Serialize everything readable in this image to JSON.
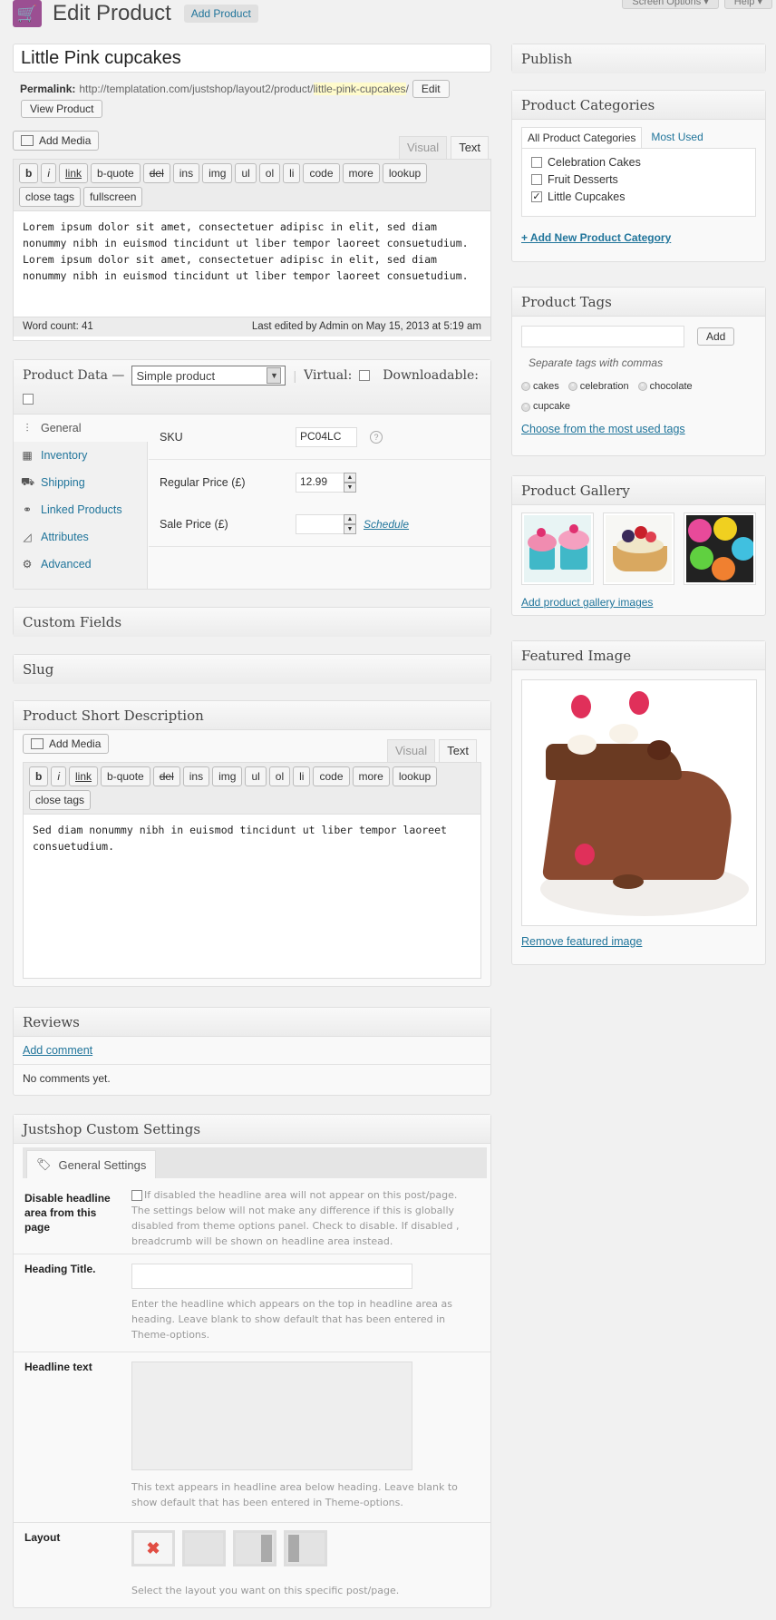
{
  "header": {
    "title": "Edit Product",
    "add_new": "Add Product",
    "screen_options": "Screen Options ▾",
    "help": "Help ▾"
  },
  "post": {
    "title": "Little Pink cupcakes",
    "permalink_label": "Permalink:",
    "permalink_base": "http://templatation.com/justshop/layout2/product/",
    "permalink_slug": "little-pink-cupcakes",
    "permalink_end": "/",
    "edit_btn": "Edit",
    "view_btn": "View Product"
  },
  "editor": {
    "add_media": "Add Media",
    "tab_visual": "Visual",
    "tab_text": "Text",
    "buttons": [
      "b",
      "i",
      "link",
      "b-quote",
      "del",
      "ins",
      "img",
      "ul",
      "ol",
      "li",
      "code",
      "more",
      "lookup",
      "close tags",
      "fullscreen"
    ],
    "content": "Lorem ipsum dolor sit amet, consectetuer adipisc in elit, sed diam nonummy nibh in euismod tincidunt ut liber tempor laoreet consuetudium. Lorem ipsum dolor sit amet, consectetuer adipisc in elit, sed diam nonummy nibh in euismod tincidunt ut liber tempor laoreet consuetudium.",
    "word_count": "Word count: 41",
    "last_edited": "Last edited by Admin on May 15, 2013 at 5:19 am"
  },
  "product_data": {
    "title": "Product Data —",
    "type": "Simple product",
    "virtual": "Virtual:",
    "downloadable": "Downloadable:",
    "tabs": [
      {
        "label": "General",
        "icon": "sliders-icon"
      },
      {
        "label": "Inventory",
        "icon": "boxes-icon"
      },
      {
        "label": "Shipping",
        "icon": "truck-icon"
      },
      {
        "label": "Linked Products",
        "icon": "link-icon"
      },
      {
        "label": "Attributes",
        "icon": "ruler-icon"
      },
      {
        "label": "Advanced",
        "icon": "gear-icon"
      }
    ],
    "sku_label": "SKU",
    "sku_value": "PC04LC",
    "regular_label": "Regular Price (£)",
    "regular_value": "12.99",
    "sale_label": "Sale Price (£)",
    "sale_value": "",
    "schedule": "Schedule"
  },
  "boxes": {
    "custom_fields": "Custom Fields",
    "slug": "Slug",
    "short_desc": "Product Short Description",
    "reviews": "Reviews"
  },
  "short_desc": {
    "add_media": "Add Media",
    "tab_visual": "Visual",
    "tab_text": "Text",
    "buttons": [
      "b",
      "i",
      "link",
      "b-quote",
      "del",
      "ins",
      "img",
      "ul",
      "ol",
      "li",
      "code",
      "more",
      "lookup",
      "close tags"
    ],
    "content": "Sed diam nonummy nibh in euismod tincidunt ut liber tempor laoreet consuetudium."
  },
  "reviews": {
    "add_comment": "Add comment",
    "empty": "No comments yet."
  },
  "justshop": {
    "title": "Justshop Custom Settings",
    "tab": "General Settings",
    "disable_label": "Disable headline area from this page",
    "disable_desc": "If disabled the headline area will not appear on this post/page. The settings below will not make any difference if this is globally disabled from theme options panel. Check to disable. If disabled , breadcrumb will be shown on headline area instead.",
    "heading_label": "Heading Title.",
    "heading_desc": "Enter the headline which appears on the top in headline area as heading. Leave blank to show default that has been entered in Theme-options.",
    "headline_label": "Headline text",
    "headline_desc": "This text appears in headline area below heading. Leave blank to show default that has been entered in Theme-options.",
    "layout_label": "Layout",
    "layout_desc": "Select the layout you want on this specific post/page."
  },
  "sidebar": {
    "publish": "Publish",
    "categories_title": "Product Categories",
    "cat_tab_all": "All Product Categories",
    "cat_tab_used": "Most Used",
    "categories": [
      {
        "label": "Celebration Cakes",
        "checked": false
      },
      {
        "label": "Fruit Desserts",
        "checked": false
      },
      {
        "label": "Little Cupcakes",
        "checked": true
      }
    ],
    "add_category": "+ Add New Product Category",
    "tags_title": "Product Tags",
    "tag_add": "Add",
    "tag_hint": "Separate tags with commas",
    "tags": [
      "cakes",
      "celebration",
      "chocolate",
      "cupcake"
    ],
    "choose_tags": "Choose from the most used tags",
    "gallery_title": "Product Gallery",
    "add_gallery": "Add product gallery images",
    "featured_title": "Featured Image",
    "remove_featured": "Remove featured image"
  }
}
